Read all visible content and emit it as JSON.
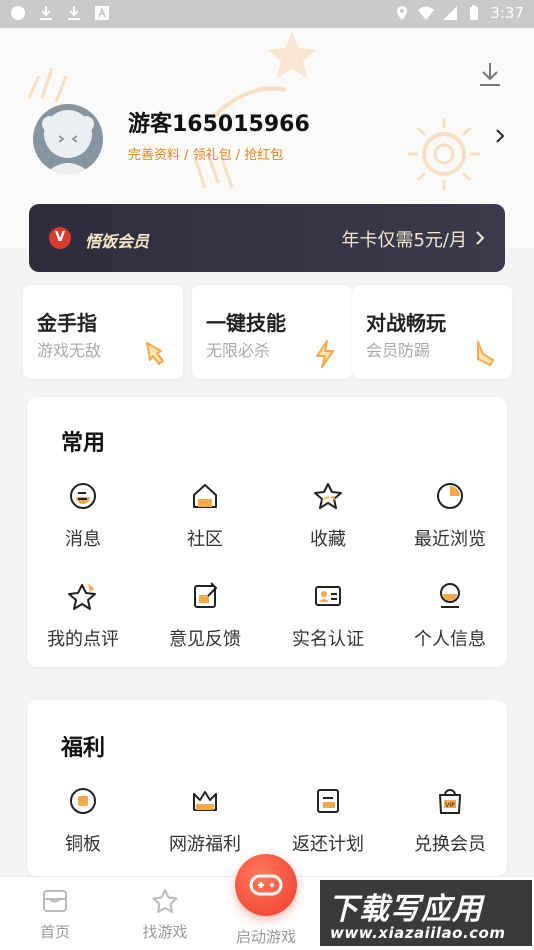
{
  "status_bar": {
    "time": "3:37"
  },
  "profile": {
    "username": "游客165015966",
    "links": "完善资料 / 领礼包 / 抢红包"
  },
  "vip": {
    "badge": "V",
    "title": "悟饭会员",
    "promo": "年卡仅需5元/月"
  },
  "features": [
    {
      "title": "金手指",
      "subtitle": "游戏无敌",
      "icon": "pointing-hand-icon"
    },
    {
      "title": "一键技能",
      "subtitle": "无限必杀",
      "icon": "lightning-icon"
    },
    {
      "title": "对战畅玩",
      "subtitle": "会员防踢",
      "icon": "kick-foot-icon"
    }
  ],
  "common": {
    "title": "常用",
    "items": [
      {
        "label": "消息",
        "icon": "message-icon"
      },
      {
        "label": "社区",
        "icon": "community-house-icon"
      },
      {
        "label": "收藏",
        "icon": "favorite-star-icon"
      },
      {
        "label": "最近浏览",
        "icon": "recent-pie-icon"
      },
      {
        "label": "我的点评",
        "icon": "review-star-icon"
      },
      {
        "label": "意见反馈",
        "icon": "feedback-edit-icon"
      },
      {
        "label": "实名认证",
        "icon": "id-card-icon"
      },
      {
        "label": "个人信息",
        "icon": "personal-info-icon"
      }
    ]
  },
  "welfare": {
    "title": "福利",
    "items": [
      {
        "label": "铜板",
        "icon": "coin-icon"
      },
      {
        "label": "网游福利",
        "icon": "crown-gift-icon"
      },
      {
        "label": "返还计划",
        "icon": "return-plan-icon"
      },
      {
        "label": "兑换会员",
        "icon": "vip-bag-icon"
      }
    ]
  },
  "bottom_nav": {
    "home": "首页",
    "find": "找游戏",
    "launch": "启动游戏"
  },
  "watermark": {
    "main": "下载写应用",
    "url": "www.xiazaiilao.com"
  },
  "colors": {
    "accent": "#e6841f",
    "vip_bg": "#2e2d3c",
    "launch_red": "#ef3b2c",
    "icon_orange": "#f4a94a"
  }
}
